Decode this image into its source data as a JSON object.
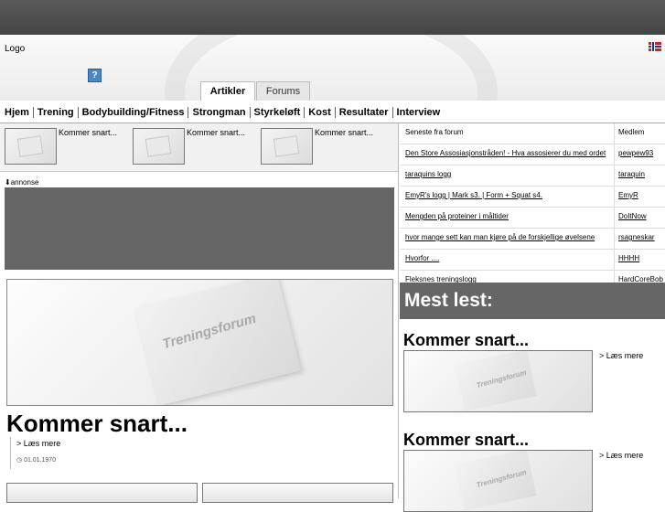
{
  "header": {
    "logo": "Logo",
    "help": "?"
  },
  "tabs": [
    {
      "label": "Artikler"
    },
    {
      "label": "Forums"
    }
  ],
  "nav": [
    "Hjem",
    "Trening",
    "Bodybuilding/Fitness",
    "Strongman",
    "Styrkeløft",
    "Kost",
    "Resultater",
    "Interview"
  ],
  "promos": [
    "Kommer snart...",
    "Kommer snart...",
    "Kommer snart..."
  ],
  "ad": {
    "label": "annonse"
  },
  "feature": {
    "watermark": "Treningsforum",
    "title": "Kommer snart...",
    "read_more": "> Læs mere",
    "date": "01.01.1970"
  },
  "forum": {
    "col_topic": "Seneste fra forum",
    "col_member": "Medlem",
    "rows": [
      {
        "topic": "Den Store Assosiasjonstråden! - Hva assosierer du med ordet",
        "member": "pewpew93"
      },
      {
        "topic": "taraquins logg",
        "member": "taraquin"
      },
      {
        "topic": "EmyR's logg | Mark s3. | Form + Squat s4.",
        "member": "EmyR"
      },
      {
        "topic": "Mengden på proteiner i måltider",
        "member": "DoItNow"
      },
      {
        "topic": "hvor mange sett kan man kjøre på de forskjellige øvelsene",
        "member": "rsagneskar"
      },
      {
        "topic": "Hvorfor ....",
        "member": "HHHH"
      },
      {
        "topic": "Fleksnes treningslogg",
        "member": "HardCoreBob"
      }
    ]
  },
  "most_read": {
    "title": "Mest lest:",
    "items": [
      {
        "title": "Kommer snart...",
        "read_more": "> Læs mere"
      },
      {
        "title": "Kommer snart...",
        "read_more": "> Læs mere"
      }
    ]
  }
}
